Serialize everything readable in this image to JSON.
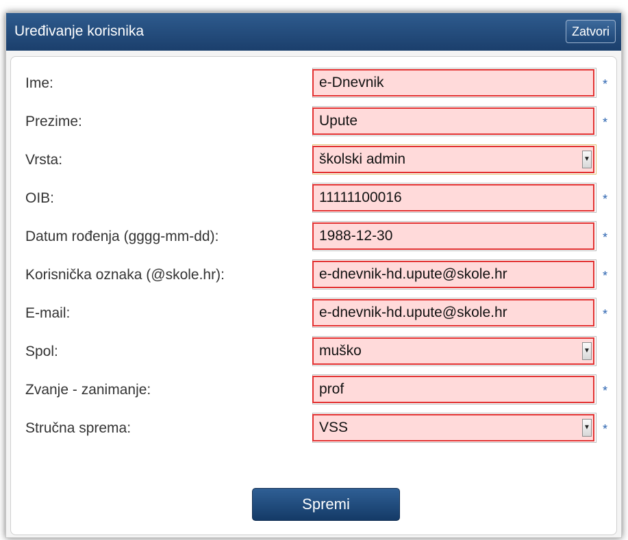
{
  "dialog": {
    "title": "Uređivanje korisnika",
    "close_label": "Zatvori"
  },
  "form": {
    "fields": [
      {
        "label": "Ime:",
        "value": "e-Dnevnik",
        "type": "text",
        "required": true
      },
      {
        "label": "Prezime:",
        "value": "Upute",
        "type": "text",
        "required": true
      },
      {
        "label": "Vrsta:",
        "value": "školski admin",
        "type": "select",
        "required": false
      },
      {
        "label": "OIB:",
        "value": "11111100016",
        "type": "text",
        "required": true
      },
      {
        "label": "Datum rođenja (gggg-mm-dd):",
        "value": "1988-12-30",
        "type": "text",
        "required": true
      },
      {
        "label": "Korisnička oznaka (@skole.hr):",
        "value": "e-dnevnik-hd.upute@skole.hr",
        "type": "text",
        "required": true
      },
      {
        "label": "E-mail:",
        "value": "e-dnevnik-hd.upute@skole.hr",
        "type": "text",
        "required": true
      },
      {
        "label": "Spol:",
        "value": "muško",
        "type": "select",
        "required": false
      },
      {
        "label": "Zvanje - zanimanje:",
        "value": "prof",
        "type": "text",
        "required": true
      },
      {
        "label": "Stručna sprema:",
        "value": "VSS",
        "type": "select",
        "required": true
      }
    ],
    "required_marker": "*",
    "save_label": "Spremi"
  },
  "colors": {
    "titlebar": "#1f4675",
    "field_background": "#ffdada",
    "field_border": "#e23030",
    "required_marker": "#2a63b0"
  },
  "icons": {
    "select_arrow": "chevron-down-icon"
  }
}
